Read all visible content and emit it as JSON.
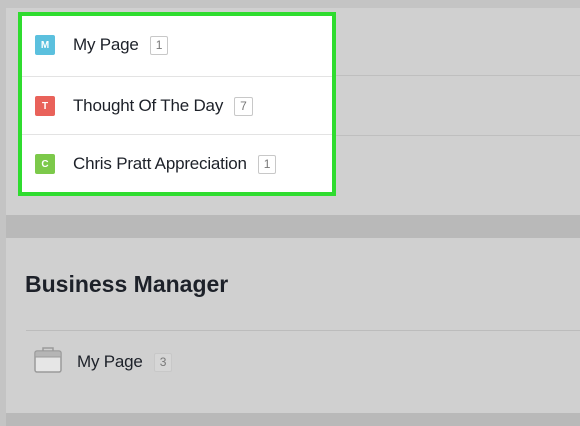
{
  "pages_list": {
    "items": [
      {
        "icon_letter": "M",
        "icon_color": "#5bc0de",
        "label": "My Page",
        "count": "1"
      },
      {
        "icon_letter": "T",
        "icon_color": "#e9625a",
        "label": "Thought Of The Day",
        "count": "7"
      },
      {
        "icon_letter": "C",
        "icon_color": "#7cc94a",
        "label": "Chris Pratt Appreciation",
        "count": "1"
      }
    ],
    "highlight_color": "#2fdc2f"
  },
  "business_manager": {
    "title": "Business Manager",
    "items": [
      {
        "icon": "briefcase-icon",
        "label": "My Page",
        "count": "3"
      }
    ]
  }
}
